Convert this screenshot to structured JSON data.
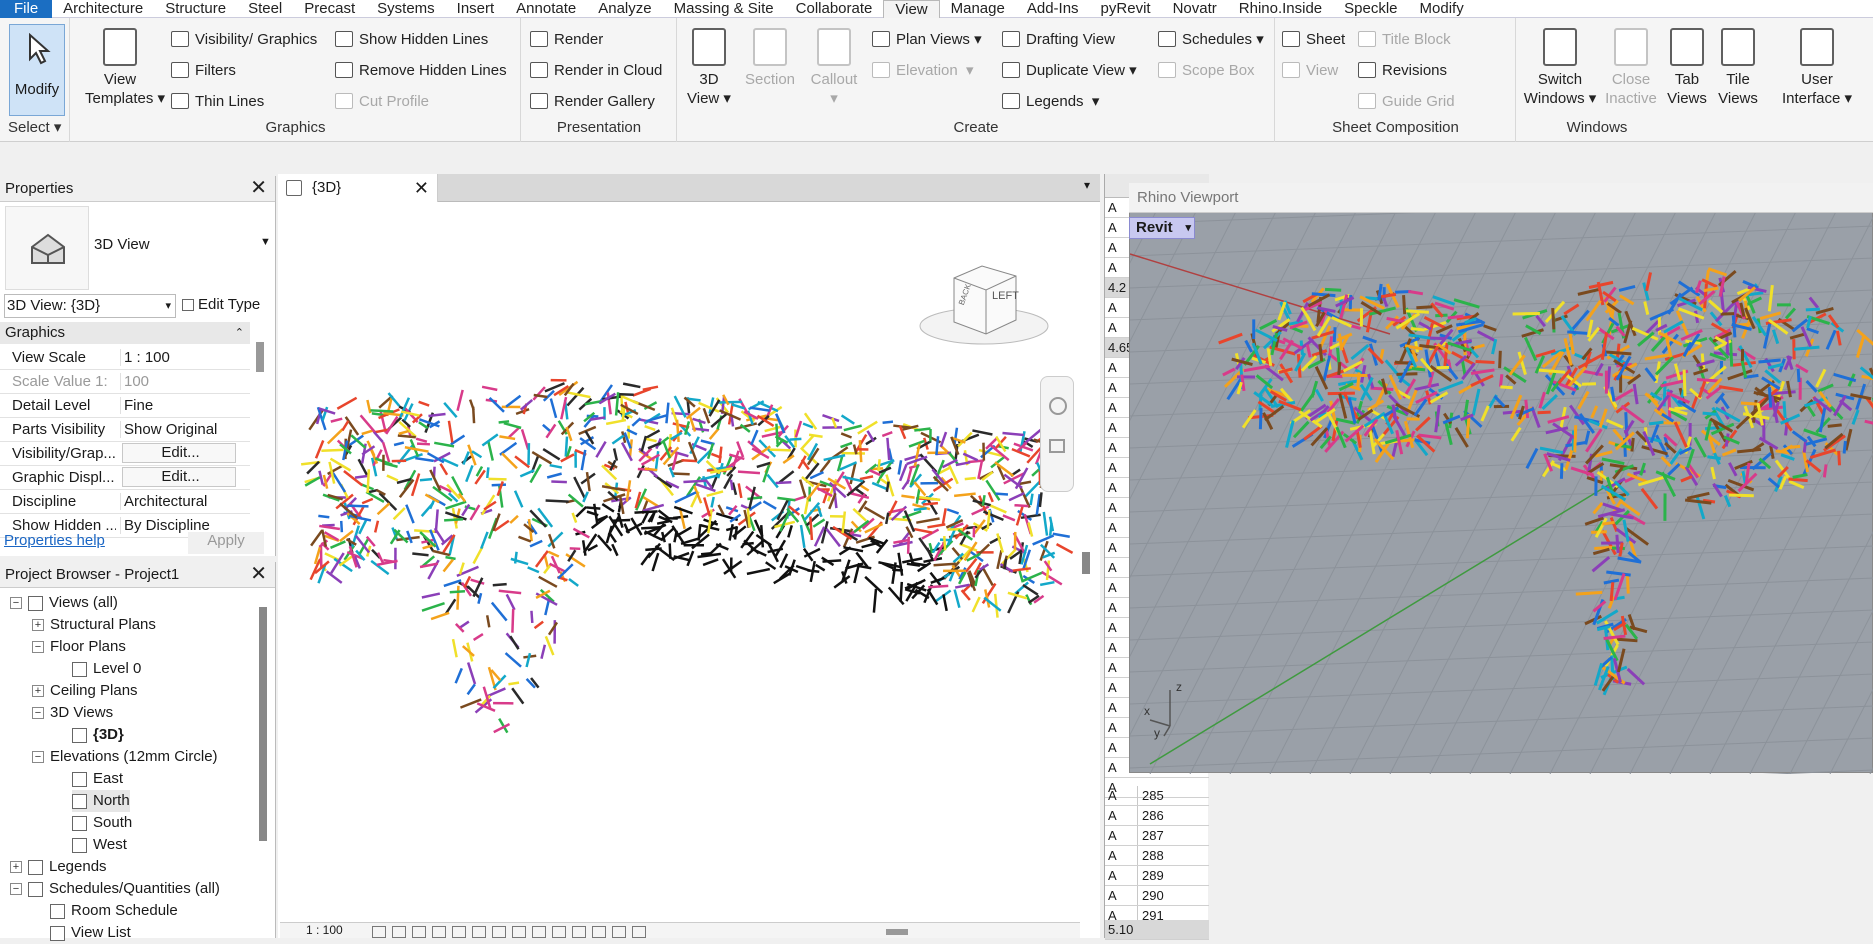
{
  "tabs": [
    "File",
    "Architecture",
    "Structure",
    "Steel",
    "Precast",
    "Systems",
    "Insert",
    "Annotate",
    "Analyze",
    "Massing & Site",
    "Collaborate",
    "View",
    "Manage",
    "Add-Ins",
    "pyRevit",
    "Novatr",
    "Rhino.Inside",
    "Speckle",
    "Modify"
  ],
  "active_tab": "View",
  "ribbon": {
    "select": {
      "modify": "Modify",
      "label": "Select"
    },
    "graphics": {
      "view_templates_1": "View",
      "view_templates_2": "Templates",
      "visibility": "Visibility/ Graphics",
      "filters": "Filters",
      "thin_lines": "Thin  Lines",
      "show_hidden": "Show  Hidden Lines",
      "remove_hidden": "Remove  Hidden Lines",
      "cut_profile": "Cut  Profile",
      "label": "Graphics"
    },
    "presentation": {
      "render": "Render",
      "render_cloud": "Render  in Cloud",
      "render_gallery": "Render  Gallery",
      "label": "Presentation"
    },
    "create": {
      "view3d_1": "3D",
      "view3d_2": "View",
      "section": "Section",
      "callout": "Callout",
      "plan_views": "Plan  Views",
      "elevation": "Elevation",
      "drafting": "Drafting  View",
      "duplicate": "Duplicate  View",
      "legends": "Legends",
      "schedules": "Schedules",
      "scope_box": "Scope  Box",
      "label": "Create"
    },
    "sheet": {
      "sheet": "Sheet",
      "view": "View",
      "title_block": "Title  Block",
      "revisions": "Revisions",
      "guide_grid": "Guide  Grid",
      "label": "Sheet Composition"
    },
    "windows": {
      "switch_1": "Switch",
      "switch_2": "Windows",
      "close_1": "Close",
      "close_2": "Inactive",
      "tab_1": "Tab",
      "tab_2": "Views",
      "tile_1": "Tile",
      "tile_2": "Views",
      "ui_1": "User",
      "ui_2": "Interface",
      "label": "Windows"
    }
  },
  "properties": {
    "title": "Properties",
    "type": "3D View",
    "selector": "3D View: {3D}",
    "edit_type": "Edit Type",
    "section": "Graphics",
    "rows": [
      {
        "k": "View Scale",
        "v": "1 : 100"
      },
      {
        "k": "Scale Value   1:",
        "v": "100"
      },
      {
        "k": "Detail Level",
        "v": "Fine"
      },
      {
        "k": "Parts Visibility",
        "v": "Show Original"
      },
      {
        "k": "Visibility/Grap...",
        "v": "Edit..."
      },
      {
        "k": "Graphic Displ...",
        "v": "Edit..."
      },
      {
        "k": "Discipline",
        "v": "Architectural"
      },
      {
        "k": "Show Hidden ...",
        "v": "By Discipline"
      }
    ],
    "help": "Properties help",
    "apply": "Apply"
  },
  "browser": {
    "title": "Project Browser - Project1",
    "nodes": [
      {
        "t": "Views (all)",
        "lvl": 0,
        "exp": "-"
      },
      {
        "t": "Structural Plans",
        "lvl": 1,
        "exp": "+"
      },
      {
        "t": "Floor Plans",
        "lvl": 1,
        "exp": "-"
      },
      {
        "t": "Level 0",
        "lvl": 2,
        "exp": ""
      },
      {
        "t": "Ceiling Plans",
        "lvl": 1,
        "exp": "+"
      },
      {
        "t": "3D Views",
        "lvl": 1,
        "exp": "-"
      },
      {
        "t": "{3D}",
        "lvl": 2,
        "exp": ""
      },
      {
        "t": "Elevations (12mm Circle)",
        "lvl": 1,
        "exp": "-"
      },
      {
        "t": "East",
        "lvl": 2,
        "exp": ""
      },
      {
        "t": "North",
        "lvl": 2,
        "exp": ""
      },
      {
        "t": "South",
        "lvl": 2,
        "exp": ""
      },
      {
        "t": "West",
        "lvl": 2,
        "exp": ""
      },
      {
        "t": "Legends",
        "lvl": 0,
        "exp": "+"
      },
      {
        "t": "Schedules/Quantities (all)",
        "lvl": 0,
        "exp": "-"
      },
      {
        "t": "Room Schedule",
        "lvl": 1,
        "exp": ""
      },
      {
        "t": "View List",
        "lvl": 1,
        "exp": ""
      }
    ]
  },
  "view": {
    "tab": "{3D}",
    "scale": "1 : 100",
    "cube_left": "LEFT",
    "cube_back": "BACK"
  },
  "schedule": {
    "rows": [
      "A",
      "A",
      "A",
      "A",
      "4.2",
      "A",
      "A",
      "4.65",
      "A",
      "A",
      "A",
      "A",
      "A",
      "A",
      "A",
      "A",
      "A",
      "A",
      "A",
      "A",
      "A",
      "A",
      "A",
      "A",
      "A",
      "A",
      "A",
      "A",
      "A",
      "A"
    ],
    "numbered": [
      {
        "c1": "A",
        "c2": "285"
      },
      {
        "c1": "A",
        "c2": "286"
      },
      {
        "c1": "A",
        "c2": "287"
      },
      {
        "c1": "A",
        "c2": "288"
      },
      {
        "c1": "A",
        "c2": "289"
      },
      {
        "c1": "A",
        "c2": "290"
      },
      {
        "c1": "A",
        "c2": "291"
      }
    ],
    "footer": "5.10"
  },
  "rhino": {
    "title": "Rhino Viewport",
    "tag": "Revit",
    "axis_x": "x",
    "axis_y": "y",
    "axis_z": "z"
  }
}
